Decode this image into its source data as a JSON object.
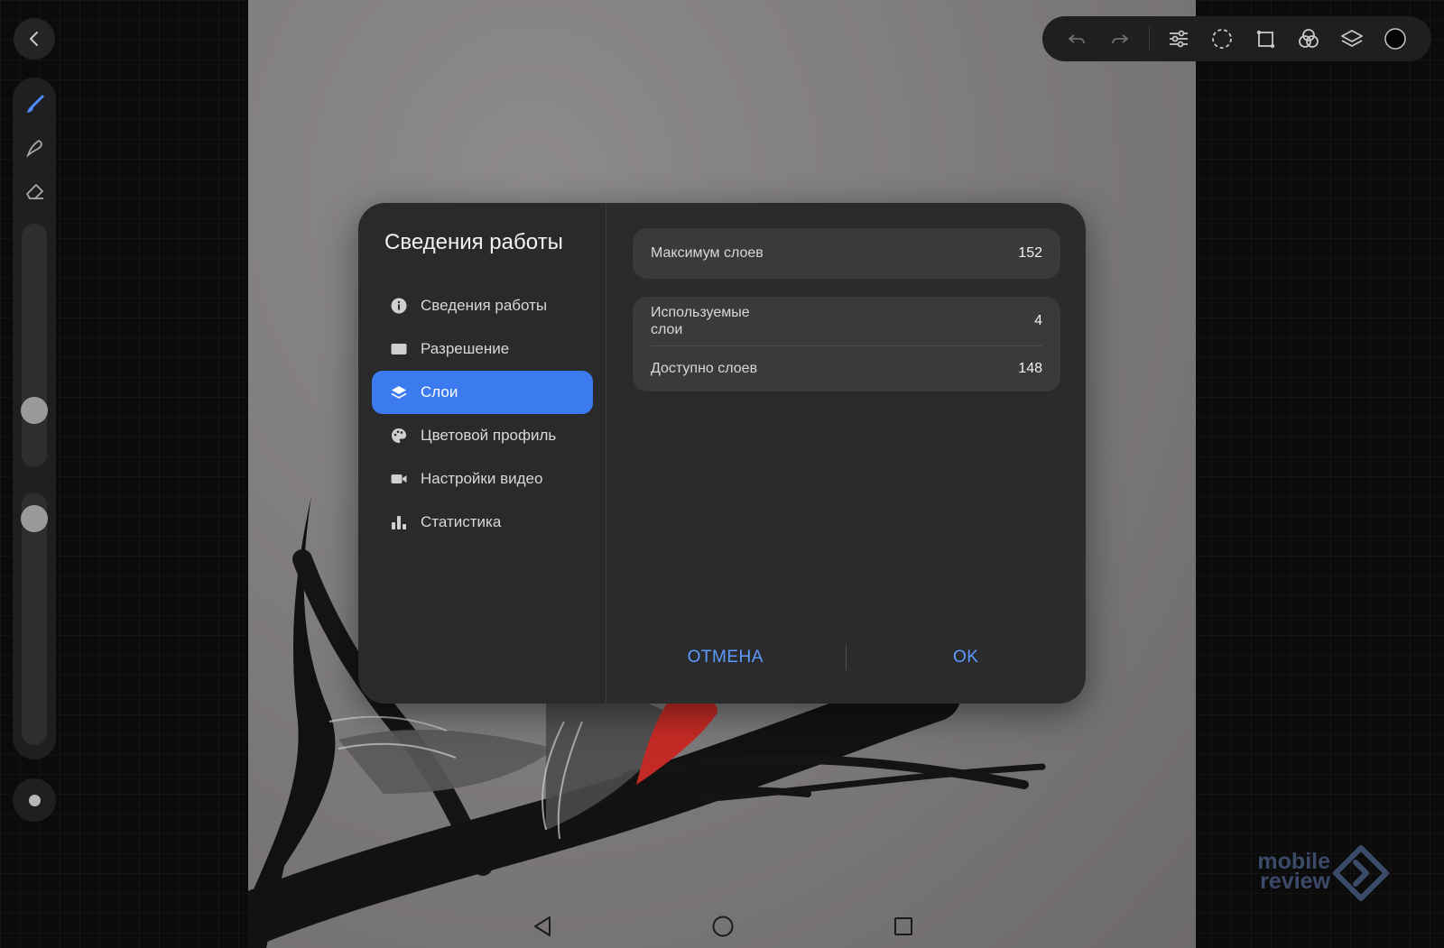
{
  "dialog": {
    "title": "Сведения работы",
    "nav": [
      {
        "label": "Сведения работы",
        "icon": "info-icon"
      },
      {
        "label": "Разрешение",
        "icon": "resolution-icon"
      },
      {
        "label": "Слои",
        "icon": "layers-icon",
        "active": true
      },
      {
        "label": "Цветовой профиль",
        "icon": "palette-icon"
      },
      {
        "label": "Настройки видео",
        "icon": "video-icon"
      },
      {
        "label": "Статистика",
        "icon": "stats-icon"
      }
    ],
    "max_layers": {
      "label": "Максимум слоев",
      "value": "152"
    },
    "used_layers": {
      "label": "Используемые\nслои",
      "value": "4"
    },
    "available_layers": {
      "label": "Доступно слоев",
      "value": "148"
    },
    "cancel_label": "ОТМЕНА",
    "ok_label": "OK"
  },
  "watermark": {
    "line1": "mobile",
    "line2": "review"
  },
  "colors": {
    "accent": "#3b7bef",
    "button_text": "#5c9cff",
    "dialog_bg": "#2b2b2d",
    "card_bg": "#3a3a3c"
  },
  "sliders": {
    "brush_size": 0.75,
    "opacity": 0.1
  },
  "toolbar": {
    "left": [
      "back-icon",
      "brush-icon",
      "smudge-icon",
      "eraser-icon"
    ],
    "top": [
      "undo-icon",
      "redo-icon",
      "adjustments-icon",
      "selection-icon",
      "transform-icon",
      "blend-icon",
      "layers-icon",
      "color-icon"
    ]
  }
}
